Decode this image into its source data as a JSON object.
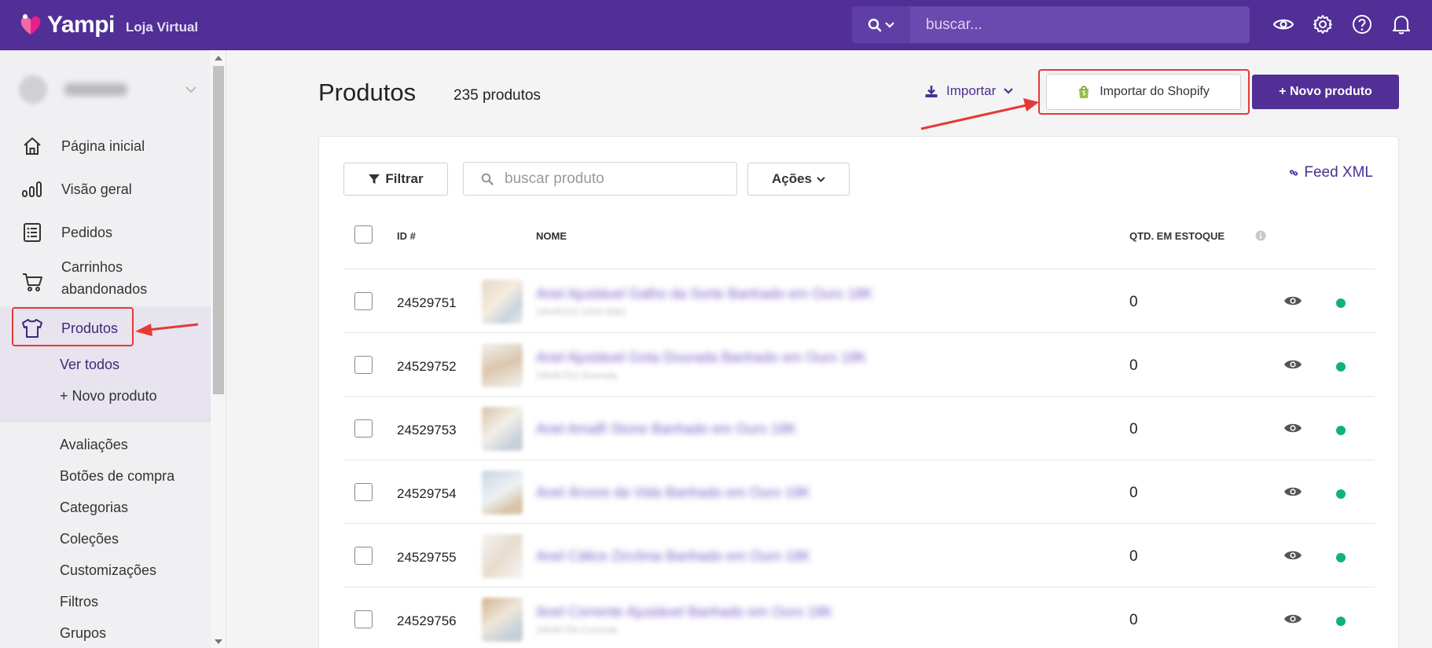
{
  "topbar": {
    "brand_name": "Yampi",
    "brand_sub": "Loja Virtual",
    "search_placeholder": "buscar...",
    "colors": {
      "bar": "#512f96",
      "accent": "#e91e8c"
    }
  },
  "sidebar": {
    "items": [
      {
        "label": "Página inicial",
        "icon": "home-icon"
      },
      {
        "label": "Visão geral",
        "icon": "bar-chart-icon"
      },
      {
        "label": "Pedidos",
        "icon": "list-icon"
      },
      {
        "label": "Carrinhos",
        "label2": "abandonados",
        "icon": "cart-icon"
      },
      {
        "label": "Produtos",
        "icon": "shirt-icon"
      }
    ],
    "sub_items": [
      {
        "label": "Ver todos"
      },
      {
        "label": "+ Novo produto"
      }
    ],
    "section_items": [
      {
        "label": "Avaliações"
      },
      {
        "label": "Botões de compra"
      },
      {
        "label": "Categorias"
      },
      {
        "label": "Coleções"
      },
      {
        "label": "Customizações"
      },
      {
        "label": "Filtros"
      },
      {
        "label": "Grupos"
      }
    ]
  },
  "header": {
    "title": "Produtos",
    "count": "235 produtos",
    "import_label": "Importar",
    "shopify_label": "Importar do Shopify",
    "new_label": "+ Novo produto"
  },
  "toolbar": {
    "filter_label": "Filtrar",
    "search_placeholder": "buscar produto",
    "actions_label": "Ações",
    "feed_label": "Feed XML"
  },
  "table": {
    "columns": {
      "id": "ID #",
      "name": "NOME",
      "stock": "QTD. EM ESTOQUE"
    },
    "rows": [
      {
        "id": "24529751",
        "name": "Anel Ajustável Galho da Sorte Banhado em Ouro 18K",
        "sub": "24545210-1563-0082",
        "qty": "0"
      },
      {
        "id": "24529752",
        "name": "Anel Ajustável Gota Dourada Banhado em Ouro 18K",
        "sub": "24545752-Dourada",
        "qty": "0"
      },
      {
        "id": "24529753",
        "name": "Anel Amalfi Stone Banhado em Ouro 18K",
        "sub": "",
        "qty": "0"
      },
      {
        "id": "24529754",
        "name": "Anel Árvore da Vida Banhado em Ouro 18K",
        "sub": "",
        "qty": "0"
      },
      {
        "id": "24529755",
        "name": "Anel Cálice Zircônia Banhado em Ouro 18K",
        "sub": "",
        "qty": "0"
      },
      {
        "id": "24529756",
        "name": "Anel Corrente Ajustável Banhado em Ouro 18K",
        "sub": "24545756-Corrente",
        "qty": "0"
      }
    ]
  }
}
